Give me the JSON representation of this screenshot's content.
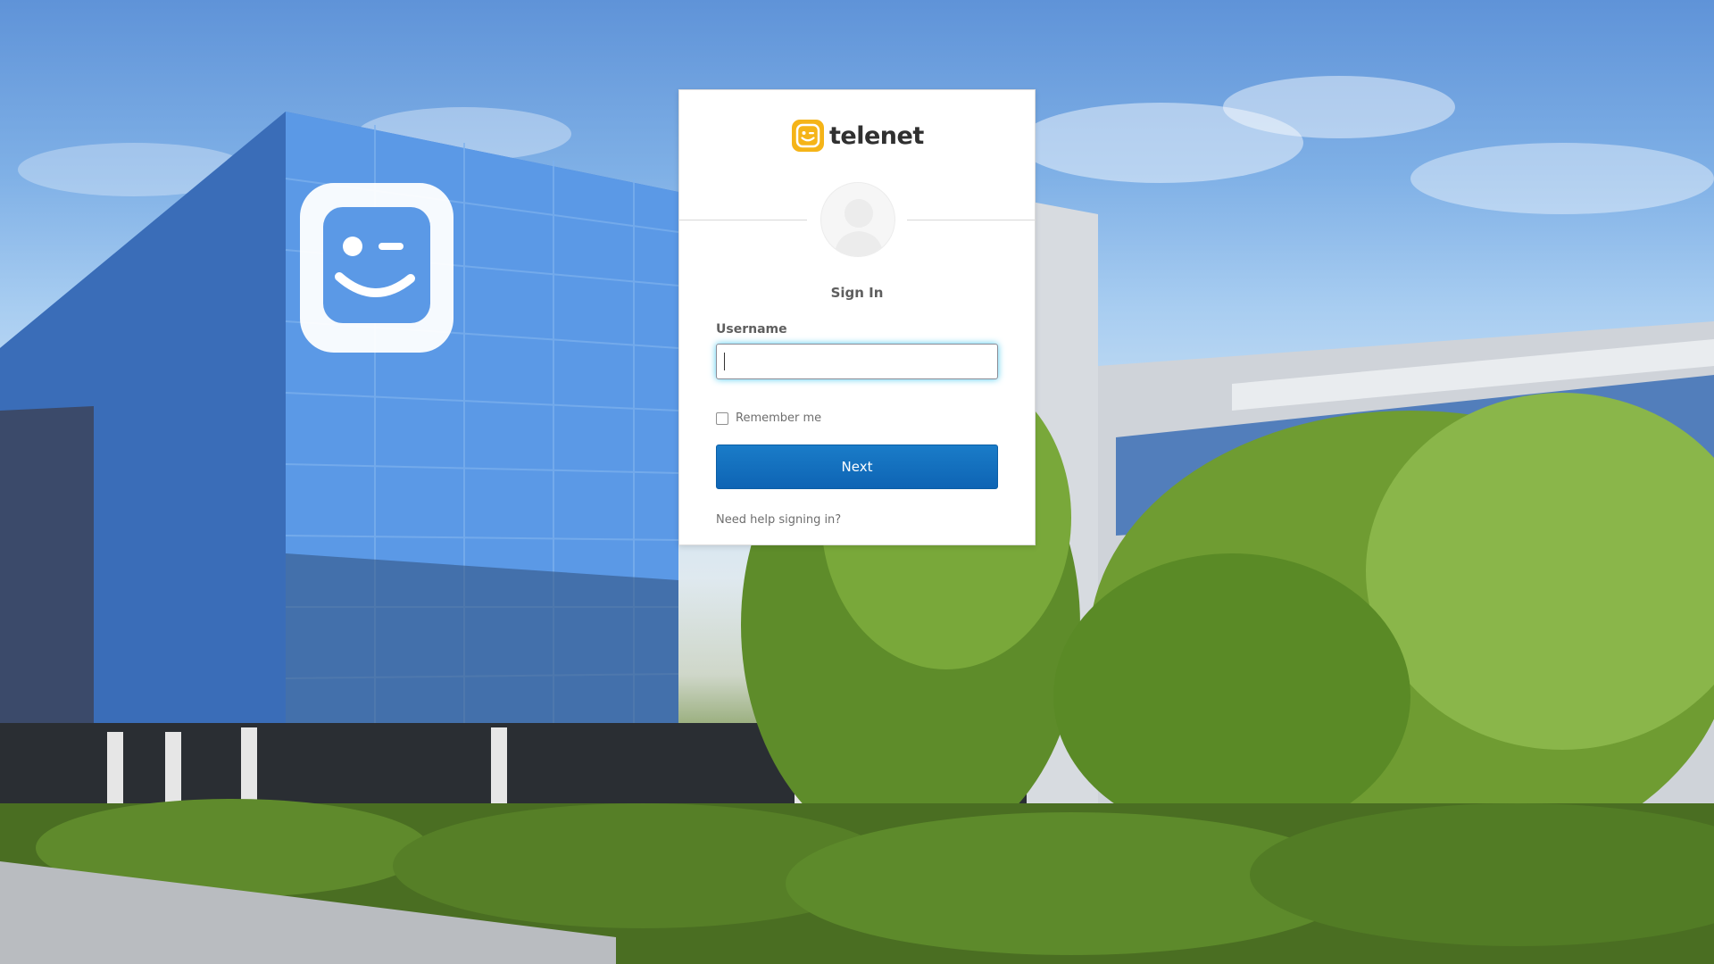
{
  "brand": {
    "name": "telenet",
    "accent": "#f5b418",
    "logo_icon": "smiley-icon"
  },
  "background": {
    "description_icon": "office-building-photo"
  },
  "login": {
    "heading": "Sign In",
    "username_label": "Username",
    "username_value": "",
    "remember_label": "Remember me",
    "remember_checked": false,
    "next_label": "Next",
    "help_link": "Need help signing in?"
  },
  "colors": {
    "button": "#0e64b4",
    "focus_glow": "#51cbee"
  }
}
